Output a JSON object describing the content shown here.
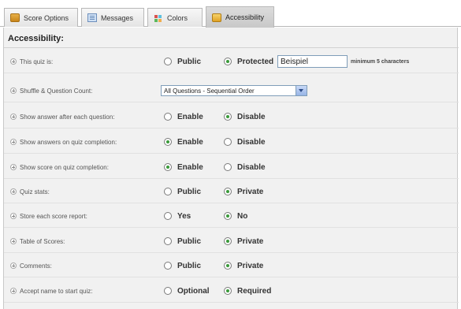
{
  "tabs": [
    {
      "label": "Score Options",
      "icon": "score-icon"
    },
    {
      "label": "Messages",
      "icon": "messages-icon"
    },
    {
      "label": "Colors",
      "icon": "colors-icon"
    },
    {
      "label": "Accessibility",
      "icon": "accessibility-icon",
      "active": true
    }
  ],
  "section_title": "Accessibility:",
  "rows": {
    "quiz_access": {
      "label": "This quiz is:",
      "options": [
        {
          "label": "Public",
          "selected": false
        },
        {
          "label": "Protected",
          "selected": true
        }
      ],
      "password_value": "Beispiel",
      "password_hint": "minimum 5 characters"
    },
    "shuffle": {
      "label": "Shuffle & Question Count:",
      "selected_value": "All Questions - Sequential Order"
    },
    "show_answer_each": {
      "label": "Show answer after each question:",
      "options": [
        {
          "label": "Enable",
          "selected": false
        },
        {
          "label": "Disable",
          "selected": true
        }
      ]
    },
    "show_answers_completion": {
      "label": "Show answers on quiz completion:",
      "options": [
        {
          "label": "Enable",
          "selected": true
        },
        {
          "label": "Disable",
          "selected": false
        }
      ]
    },
    "show_score_completion": {
      "label": "Show score on quiz completion:",
      "options": [
        {
          "label": "Enable",
          "selected": true
        },
        {
          "label": "Disable",
          "selected": false
        }
      ]
    },
    "quiz_stats": {
      "label": "Quiz stats:",
      "options": [
        {
          "label": "Public",
          "selected": false
        },
        {
          "label": "Private",
          "selected": true
        }
      ]
    },
    "store_report": {
      "label": "Store each score report:",
      "options": [
        {
          "label": "Yes",
          "selected": false
        },
        {
          "label": "No",
          "selected": true
        }
      ]
    },
    "table_scores": {
      "label": "Table of Scores:",
      "options": [
        {
          "label": "Public",
          "selected": false
        },
        {
          "label": "Private",
          "selected": true
        }
      ]
    },
    "comments": {
      "label": "Comments:",
      "options": [
        {
          "label": "Public",
          "selected": false
        },
        {
          "label": "Private",
          "selected": true
        }
      ]
    },
    "accept_name": {
      "label": "Accept name to start quiz:",
      "options": [
        {
          "label": "Optional",
          "selected": false
        },
        {
          "label": "Required",
          "selected": true
        }
      ]
    }
  },
  "colors": {
    "radio_selected": "#3a9a3a",
    "panel_bg": "#f1f1f1",
    "active_tab": "#c8c8c8"
  }
}
